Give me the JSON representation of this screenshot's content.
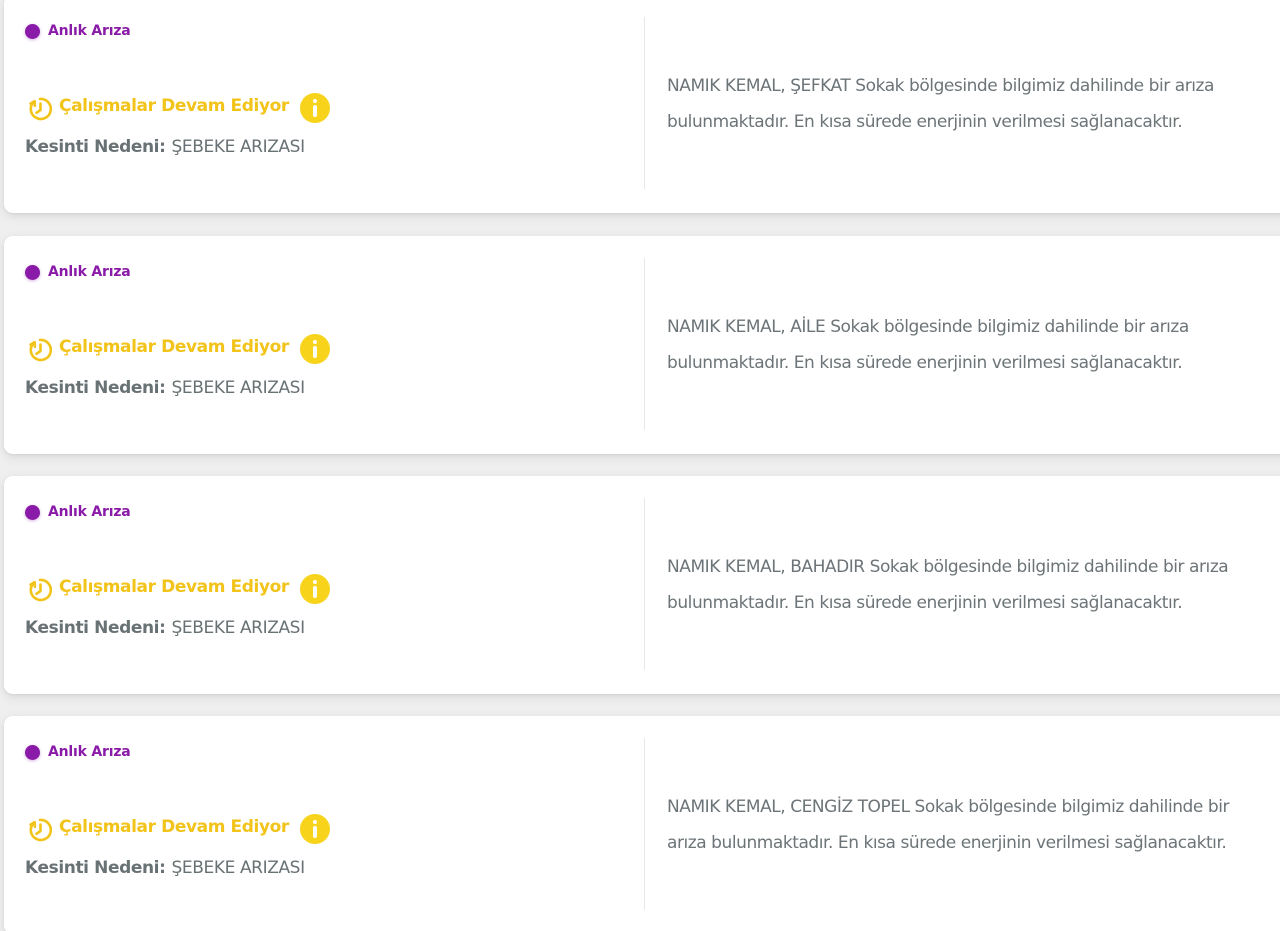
{
  "colors": {
    "type_accent": "#8a1aa8",
    "status_accent": "#f2c318",
    "text_muted": "#687174"
  },
  "outages": [
    {
      "type_label": "Anlık Arıza",
      "status_label": "Çalışmalar Devam Ediyor",
      "status_icon": "clock-refresh-icon",
      "info_icon": "info-icon",
      "reason_label": "Kesinti Nedeni:",
      "reason_value": "ŞEBEKE ARIZASI",
      "description": "NAMIK KEMAL, ŞEFKAT Sokak bölgesinde bilgimiz dahilinde bir arıza bulunmaktadır. En kısa sürede enerjinin verilmesi sağlanacaktır."
    },
    {
      "type_label": "Anlık Arıza",
      "status_label": "Çalışmalar Devam Ediyor",
      "status_icon": "clock-refresh-icon",
      "info_icon": "info-icon",
      "reason_label": "Kesinti Nedeni:",
      "reason_value": "ŞEBEKE ARIZASI",
      "description": "NAMIK KEMAL, AİLE Sokak bölgesinde bilgimiz dahilinde bir arıza bulunmaktadır. En kısa sürede enerjinin verilmesi sağlanacaktır."
    },
    {
      "type_label": "Anlık Arıza",
      "status_label": "Çalışmalar Devam Ediyor",
      "status_icon": "clock-refresh-icon",
      "info_icon": "info-icon",
      "reason_label": "Kesinti Nedeni:",
      "reason_value": "ŞEBEKE ARIZASI",
      "description": "NAMIK KEMAL, BAHADIR Sokak bölgesinde bilgimiz dahilinde bir arıza bulunmaktadır. En kısa sürede enerjinin verilmesi sağlanacaktır."
    },
    {
      "type_label": "Anlık Arıza",
      "status_label": "Çalışmalar Devam Ediyor",
      "status_icon": "clock-refresh-icon",
      "info_icon": "info-icon",
      "reason_label": "Kesinti Nedeni:",
      "reason_value": "ŞEBEKE ARIZASI",
      "description": "NAMIK KEMAL, CENGİZ TOPEL Sokak bölgesinde bilgimiz dahilinde bir arıza bulunmaktadır. En kısa sürede enerjinin verilmesi sağlanacaktır."
    }
  ]
}
